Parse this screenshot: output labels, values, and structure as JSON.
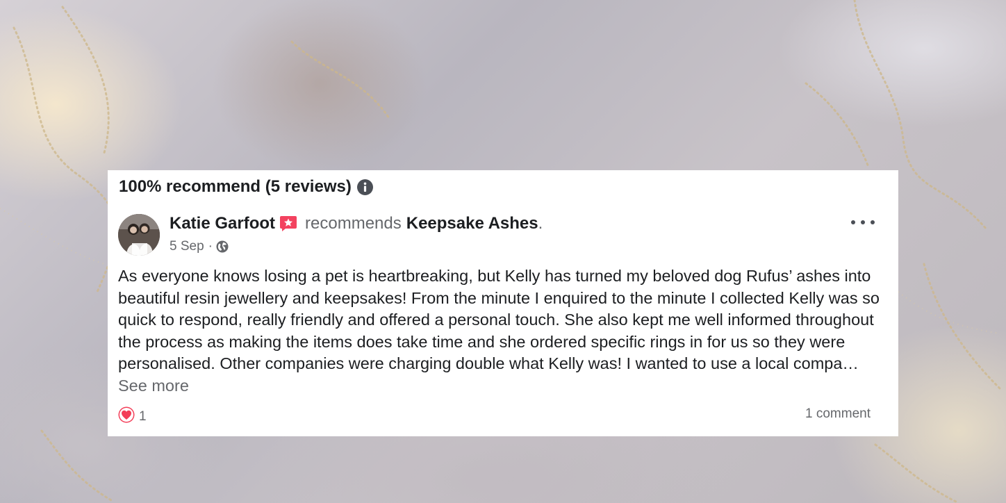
{
  "summary": {
    "title": "100% recommend (5 reviews)",
    "info_icon": "info-icon"
  },
  "review": {
    "author": "Katie Garfoot",
    "badge_icon": "recommendation-badge-icon",
    "verb": "recommends",
    "page": "Keepsake Ashes",
    "period": ".",
    "date": "5 Sep",
    "separator": "·",
    "audience_icon": "globe-icon",
    "body": "As everyone knows losing a pet is heartbreaking, but Kelly has turned my beloved dog Rufus’ ashes into beautiful resin jewellery and keepsakes! From the minute I enquired to the minute I collected Kelly was so quick to respond, really friendly and offered a personal touch. She also kept me well informed throughout the process as making the items does take time and she ordered specific rings in for us so they were personalised. Other companies were charging double what Kelly was! I wanted to use a local compa…",
    "see_more": " See more",
    "reaction_icon": "heart-icon",
    "reaction_count": "1",
    "comments": "1 comment"
  },
  "colors": {
    "text_primary": "#1c1e21",
    "text_secondary": "#65676b",
    "heart": "#f33e58",
    "badge": "#f3425f",
    "card": "#ffffff"
  }
}
